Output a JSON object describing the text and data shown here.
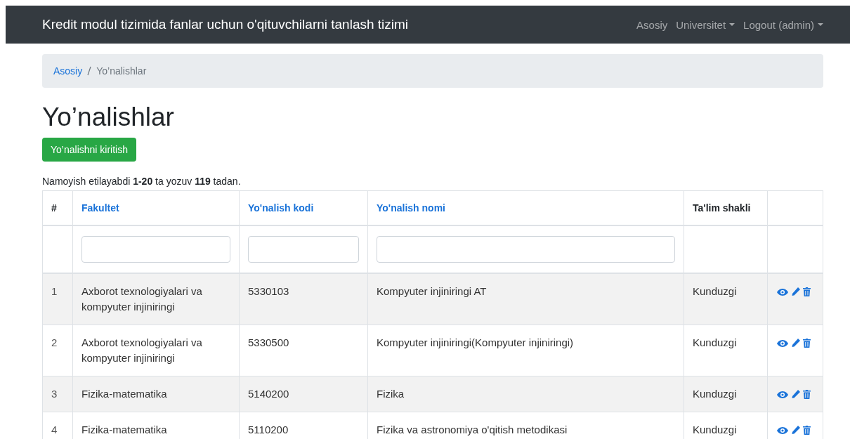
{
  "navbar": {
    "brand": "Kredit modul tizimida fanlar uchun o'qituvchilarni tanlash tizimi",
    "items": [
      {
        "label": "Asosiy",
        "dropdown": false
      },
      {
        "label": "Universitet",
        "dropdown": true
      },
      {
        "label": "Logout (admin)",
        "dropdown": true
      }
    ]
  },
  "breadcrumb": [
    {
      "label": "Asosiy",
      "link": true
    },
    {
      "label": "Yo’nalishlar",
      "link": false
    }
  ],
  "title": "Yo’nalishlar",
  "create_button": "Yo’nalishni kiritish",
  "summary": "Namoyish etilayabdi **1-20** ta yozuv **119** tadan.",
  "table": {
    "columns": [
      {
        "label": "#",
        "sortable": false
      },
      {
        "label": "Fakultet",
        "sortable": true
      },
      {
        "label": "Yo'nalish kodi",
        "sortable": true
      },
      {
        "label": "Yo'nalish nomi",
        "sortable": true
      },
      {
        "label": "Ta'lim shakli",
        "sortable": false
      }
    ],
    "filters": [
      {
        "kind": "none"
      },
      {
        "kind": "input"
      },
      {
        "kind": "input"
      },
      {
        "kind": "input"
      },
      {
        "kind": "none"
      },
      {
        "kind": "none"
      }
    ],
    "rows": [
      {
        "cells": [
          "1",
          "Axborot texnologiyalari va kompyuter injiniringi",
          "5330103",
          "Kompyuter injiniringi AT",
          "Kunduzgi"
        ]
      },
      {
        "cells": [
          "2",
          "Axborot texnologiyalari va kompyuter injiniringi",
          "5330500",
          "Kompyuter injiniringi(Kompyuter injiniringi)",
          "Kunduzgi"
        ]
      },
      {
        "cells": [
          "3",
          "Fizika-matematika",
          "5140200",
          "Fizika",
          "Kunduzgi"
        ]
      },
      {
        "cells": [
          "4",
          "Fizika-matematika",
          "5110200",
          "Fizika va astronomiya o'qitish metodikasi",
          "Kunduzgi"
        ]
      }
    ]
  }
}
